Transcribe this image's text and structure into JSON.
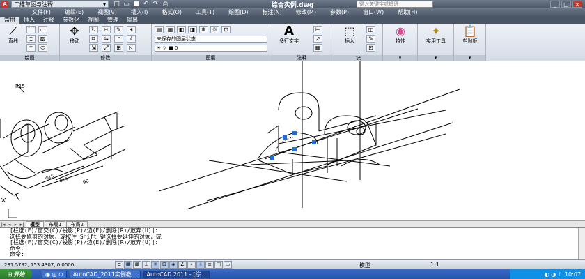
{
  "titlebar": {
    "workspace": "二维草图与注释",
    "title": "综合实例.dwg",
    "search_placeholder": "键入关键字或短语",
    "app_letter": "A"
  },
  "menu": [
    "文件(F)",
    "编辑(E)",
    "视图(V)",
    "插入(I)",
    "格式(O)",
    "工具(T)",
    "绘图(D)",
    "标注(N)",
    "修改(M)",
    "参数(P)",
    "窗口(W)",
    "帮助(H)"
  ],
  "tabs": [
    "常用",
    "插入",
    "注释",
    "参数化",
    "视图",
    "管理",
    "输出"
  ],
  "ribbon": {
    "draw": {
      "big_label": "直线",
      "panel_label": "绘图"
    },
    "modify": {
      "big_label": "移动",
      "panel_label": "修改"
    },
    "layers": {
      "state": "未保存的图层状态",
      "layer_name": "0",
      "panel_label": "图层"
    },
    "annotation": {
      "big_label": "多行文字",
      "panel_label": "注释"
    },
    "block": {
      "big_label": "插入",
      "panel_label": "块"
    },
    "properties": {
      "big_label": "特性"
    },
    "utilities": {
      "big_label": "实用工具"
    },
    "clipboard": {
      "big_label": "剪贴板"
    }
  },
  "drawing": {
    "dimensions": [
      "R15",
      "90",
      "Φ14",
      "Φ15"
    ]
  },
  "layout_tabs": [
    "模型",
    "布局1",
    "布局2"
  ],
  "command_lines": [
    "[栏选(F)/窗交(C)/投影(P)/边(E)/删除(R)/放弃(U)]:",
    "选择要修剪的对象，或按住 Shift 键选择要延伸的对象，或",
    "[栏选(F)/窗交(C)/投影(P)/边(E)/删除(R)/放弃(U)]:",
    "命令:",
    "命令:"
  ],
  "status": {
    "coords": "231.5792, 153.4307, 0.0000",
    "model_label": "模型",
    "scale": "1:1"
  },
  "taskbar": {
    "start": "开始",
    "tasks": [
      "AutoCAD_2011实例教...",
      "AutoCAD 2011 - [综..."
    ],
    "clock": "10:07"
  }
}
